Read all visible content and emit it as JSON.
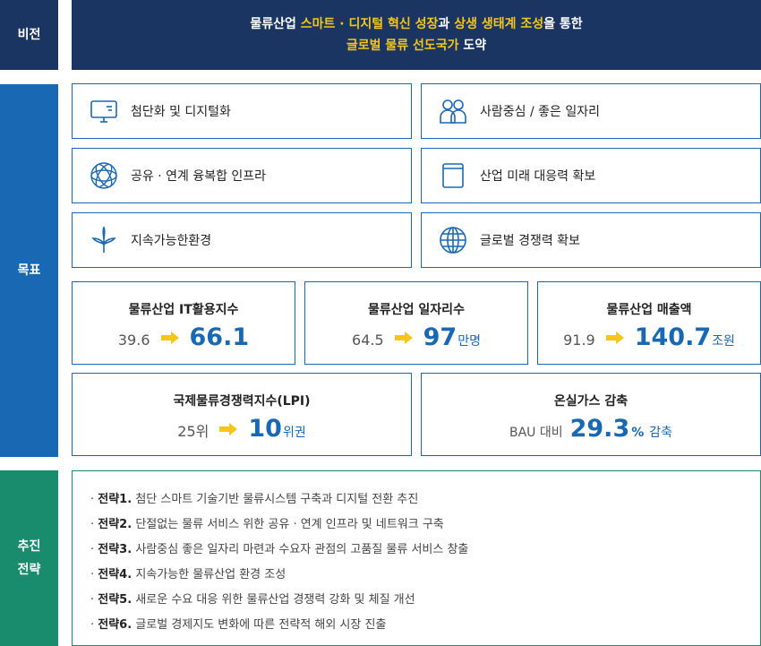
{
  "side": {
    "vision": "비전",
    "goal": "목표",
    "strategy_l1": "추진",
    "strategy_l2": "전략"
  },
  "vision": {
    "p1": "물류산업 ",
    "h1": "스마트 ",
    "p2": " · ",
    "h2": "디지털 혁신 성장",
    "p3": "과 ",
    "h3": "상생 생태계 조성",
    "p4": "을 통한",
    "h4": "글로벌 물류 선도국가",
    "p5": " 도약"
  },
  "goals": [
    {
      "label": "첨단화 및 디지털화",
      "icon": "monitor-icon"
    },
    {
      "label": "사람중심 / 좋은 일자리",
      "icon": "people-icon"
    },
    {
      "label": "공유 · 연계 융복합 인프라",
      "icon": "network-icon"
    },
    {
      "label": "산업 미래 대응력 확보",
      "icon": "book-icon"
    },
    {
      "label": "지속가능한환경",
      "icon": "sprout-icon"
    },
    {
      "label": "글로벌 경쟁력 확보",
      "icon": "globe-icon"
    }
  ],
  "metrics": [
    {
      "title": "물류산업 IT활용지수",
      "from": "39.6",
      "to": "66.1",
      "unit": ""
    },
    {
      "title": "물류산업 일자리수",
      "from": "64.5",
      "to": "97",
      "unit": "만명"
    },
    {
      "title": "물류산업 매출액",
      "from": "91.9",
      "to": "140.7",
      "unit": "조원"
    },
    {
      "title": "국제물류경쟁력지수(LPI)",
      "from": "25위",
      "to": "10",
      "unit": "위권"
    },
    {
      "title": "온실가스 감축",
      "pre": "BAU 대비",
      "to": "29.3",
      "unit": "%",
      "post": "감축"
    }
  ],
  "strategies": [
    {
      "num": "전략1.",
      "text": "첨단 스마트 기술기반 물류시스템 구축과 디지털 전환 추진"
    },
    {
      "num": "전략2.",
      "text": "단절없는 물류 서비스 위한 공유 · 연계 인프라 및 네트워크 구축"
    },
    {
      "num": "전략3.",
      "text": "사람중심 좋은 일자리 마련과 수요자 관점의 고품질 물류 서비스 창출"
    },
    {
      "num": "전략4.",
      "text": "지속가능한 물류산업 환경 조성"
    },
    {
      "num": "전략5.",
      "text": "새로운 수요 대응 위한 물류산업 경쟁력 강화 및 체질 개선"
    },
    {
      "num": "전략6.",
      "text": "글로벌 경제지도 변화에 따른 전략적 해외 시장 진출"
    }
  ],
  "colors": {
    "navy": "#1a3562",
    "blue": "#1868b3",
    "green": "#1a8c6e",
    "highlight": "#f5c518",
    "arrow": "#f5c518"
  }
}
